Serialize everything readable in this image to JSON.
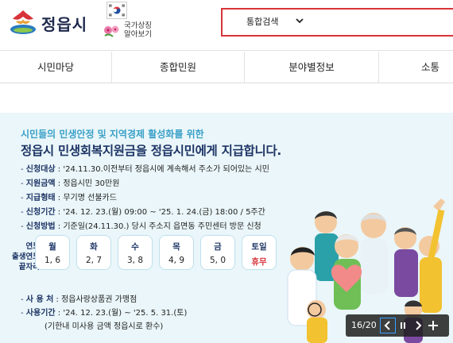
{
  "header": {
    "logo_text": "정읍시",
    "symbol_label_line1": "국가상징",
    "symbol_label_line2": "알아보기",
    "search_select": "통합검색",
    "search_placeholder": "",
    "accent_color": "#d7333a"
  },
  "nav": {
    "items": [
      {
        "label": "시민마당"
      },
      {
        "label": "종합민원"
      },
      {
        "label": "분야별정보"
      },
      {
        "label": "소통"
      }
    ]
  },
  "banner": {
    "subtitle": "시민들의 민생안정 및 지역경제 활성화를 위한",
    "title": "정읍시 민생회복지원금을 정읍시민에게 지급합니다.",
    "rows": [
      {
        "label": "신청대상",
        "value": " : '24.11.30.이전부터 정읍시에 계속해서 주소가 되어있는 시민"
      },
      {
        "label": "지원금액",
        "value": " : 정읍시민 30만원"
      },
      {
        "label": "지급형태",
        "value": " : 무기명 선불카드"
      },
      {
        "label": "신청기간",
        "value": " : '24. 12. 23.(월) 09:00 ~ '25. 1. 24.(금) 18:00 / 5주간"
      },
      {
        "label": "신청방법",
        "value": " : 기준일(24.11.30.) 당시 주소지 읍면동 주민센터 방문 신청"
      }
    ],
    "dow_side_line1": "연도",
    "dow_side_line2": "출생연도",
    "dow_side_line3": "끝자리",
    "days": [
      {
        "day": "월",
        "nums": "1, 6"
      },
      {
        "day": "화",
        "nums": "2, 7"
      },
      {
        "day": "수",
        "nums": "3, 8"
      },
      {
        "day": "목",
        "nums": "4, 9"
      },
      {
        "day": "금",
        "nums": "5, 0"
      },
      {
        "day": "토일",
        "nums": "휴무"
      }
    ],
    "use_place_label": "사 용 처",
    "use_place_value": " : 정읍사랑상품권 가맹점",
    "use_period_label": "사용기간",
    "use_period_value": " : '24. 12. 23.(월) ~ '25. 5. 31.(토)",
    "use_note": "(기한내 미사용 금액 정읍시로 환수)"
  },
  "slider": {
    "counter": "16/20",
    "prev_icon": "chevron-left-icon",
    "pause_icon": "pause-icon",
    "next_icon": "chevron-right-icon",
    "add_icon": "plus-icon"
  }
}
